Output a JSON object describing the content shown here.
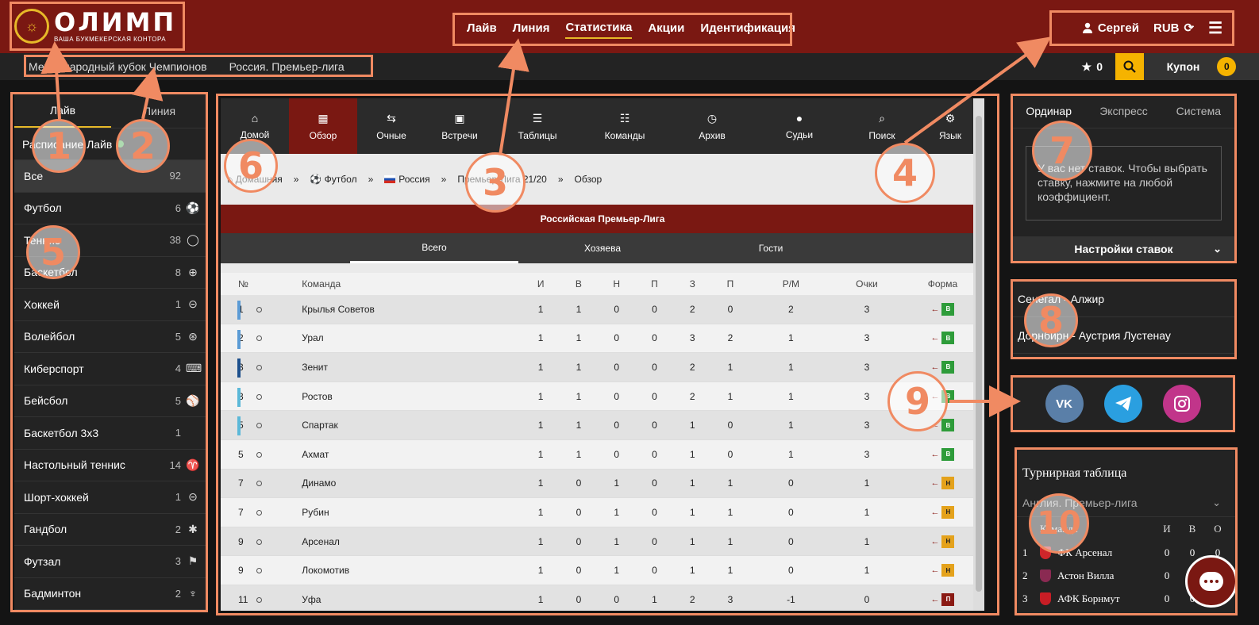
{
  "logo": {
    "name": "ОЛИМП",
    "tagline": "ВАША БУКМЕКЕРСКАЯ КОНТОРА"
  },
  "topnav": [
    "Лайв",
    "Линия",
    "Статистика",
    "Акции",
    "Идентификация"
  ],
  "user": {
    "name": "Сергей",
    "currency": "RUB"
  },
  "subbar": {
    "crumbs": [
      "Международный кубок Чемпионов",
      "Россия. Премьер-лига"
    ],
    "favorites": "0",
    "coupon_label": "Купон",
    "coupon_count": "0"
  },
  "left": {
    "tabs": [
      "Лайв",
      "Линия"
    ],
    "schedule": "Расписание Лайв",
    "sports": [
      {
        "name": "Все",
        "count": "92",
        "icon": "none"
      },
      {
        "name": "Футбол",
        "count": "6",
        "icon": "soccer-icon"
      },
      {
        "name": "Теннис",
        "count": "38",
        "icon": "tennis-icon"
      },
      {
        "name": "Баскетбол",
        "count": "8",
        "icon": "basketball-icon"
      },
      {
        "name": "Хоккей",
        "count": "1",
        "icon": "puck-icon"
      },
      {
        "name": "Волейбол",
        "count": "5",
        "icon": "volleyball-icon"
      },
      {
        "name": "Киберспорт",
        "count": "4",
        "icon": "gamepad-icon"
      },
      {
        "name": "Бейсбол",
        "count": "5",
        "icon": "baseball-icon"
      },
      {
        "name": "Баскетбол 3х3",
        "count": "1",
        "icon": "none"
      },
      {
        "name": "Настольный теннис",
        "count": "14",
        "icon": "pingpong-icon"
      },
      {
        "name": "Шорт-хоккей",
        "count": "1",
        "icon": "puck-icon"
      },
      {
        "name": "Гандбол",
        "count": "2",
        "icon": "handball-icon"
      },
      {
        "name": "Футзал",
        "count": "3",
        "icon": "futsal-icon"
      },
      {
        "name": "Бадминтон",
        "count": "2",
        "icon": "shuttlecock-icon"
      }
    ]
  },
  "stats": {
    "tabs": [
      "Домой",
      "Обзор",
      "Очные",
      "Встречи",
      "Таблицы",
      "Команды",
      "Архив",
      "Судьи",
      "Поиск",
      "Язык"
    ],
    "breadcrumb": [
      "Домашняя",
      "Футбол",
      "Россия",
      "Премьер-Лига 21/20",
      "Обзор"
    ],
    "league_title": "Российская Премьер-Лига",
    "home_away_tabs": [
      "Всего",
      "Хозяева",
      "Гости"
    ],
    "columns": [
      "№",
      "Команда",
      "И",
      "В",
      "Н",
      "П",
      "З",
      "П",
      "Р/М",
      "Очки",
      "Форма"
    ],
    "rows": [
      {
        "pos": "1",
        "team": "Крылья Советов",
        "p": "1",
        "w": "1",
        "d": "0",
        "l": "0",
        "gf": "2",
        "ga": "0",
        "gd": "2",
        "pts": "3",
        "form": "В",
        "mark": "#5b9bd5"
      },
      {
        "pos": "2",
        "team": "Урал",
        "p": "1",
        "w": "1",
        "d": "0",
        "l": "0",
        "gf": "3",
        "ga": "2",
        "gd": "1",
        "pts": "3",
        "form": "В",
        "mark": "#5b9bd5"
      },
      {
        "pos": "3",
        "team": "Зенит",
        "p": "1",
        "w": "1",
        "d": "0",
        "l": "0",
        "gf": "2",
        "ga": "1",
        "gd": "1",
        "pts": "3",
        "form": "В",
        "mark": "#1c4f8c"
      },
      {
        "pos": "3",
        "team": "Ростов",
        "p": "1",
        "w": "1",
        "d": "0",
        "l": "0",
        "gf": "2",
        "ga": "1",
        "gd": "1",
        "pts": "3",
        "form": "В",
        "mark": "#5bb8d8"
      },
      {
        "pos": "5",
        "team": "Спартак",
        "p": "1",
        "w": "1",
        "d": "0",
        "l": "0",
        "gf": "1",
        "ga": "0",
        "gd": "1",
        "pts": "3",
        "form": "В",
        "mark": "#5bb8d8"
      },
      {
        "pos": "5",
        "team": "Ахмат",
        "p": "1",
        "w": "1",
        "d": "0",
        "l": "0",
        "gf": "1",
        "ga": "0",
        "gd": "1",
        "pts": "3",
        "form": "В",
        "mark": ""
      },
      {
        "pos": "7",
        "team": "Динамо",
        "p": "1",
        "w": "0",
        "d": "1",
        "l": "0",
        "gf": "1",
        "ga": "1",
        "gd": "0",
        "pts": "1",
        "form": "Н",
        "mark": ""
      },
      {
        "pos": "7",
        "team": "Рубин",
        "p": "1",
        "w": "0",
        "d": "1",
        "l": "0",
        "gf": "1",
        "ga": "1",
        "gd": "0",
        "pts": "1",
        "form": "Н",
        "mark": ""
      },
      {
        "pos": "9",
        "team": "Арсенал",
        "p": "1",
        "w": "0",
        "d": "1",
        "l": "0",
        "gf": "1",
        "ga": "1",
        "gd": "0",
        "pts": "1",
        "form": "Н",
        "mark": ""
      },
      {
        "pos": "9",
        "team": "Локомотив",
        "p": "1",
        "w": "0",
        "d": "1",
        "l": "0",
        "gf": "1",
        "ga": "1",
        "gd": "0",
        "pts": "1",
        "form": "Н",
        "mark": ""
      },
      {
        "pos": "11",
        "team": "Уфа",
        "p": "1",
        "w": "0",
        "d": "0",
        "l": "1",
        "gf": "2",
        "ga": "3",
        "gd": "-1",
        "pts": "0",
        "form": "П",
        "mark": ""
      }
    ]
  },
  "betslip": {
    "tabs": [
      "Ординар",
      "Экспресс",
      "Система"
    ],
    "empty": "У вас нет ставок. Чтобы выбрать ставку, нажмите на любой коэффициент.",
    "settings": "Настройки ставок"
  },
  "matches": [
    "Сенегал - Алжир",
    "Дорнбирн - Аустрия Лустенау"
  ],
  "social": {
    "vk": "VK"
  },
  "standings": {
    "title": "Турнирная таблица",
    "league": "Англия. Премьер-лига",
    "head": {
      "team": "Команда",
      "cols": [
        "И",
        "В",
        "О"
      ]
    },
    "rows": [
      {
        "rank": "1",
        "team": "ФК Арсенал",
        "p": "0",
        "w": "0",
        "o": "0",
        "crest": "#d0262a"
      },
      {
        "rank": "2",
        "team": "Астон Вилла",
        "p": "0",
        "w": "0",
        "o": "0",
        "crest": "#8a2a52"
      },
      {
        "rank": "3",
        "team": "АФК Борнмут",
        "p": "0",
        "w": "0",
        "o": "0",
        "crest": "#c81d25"
      }
    ]
  },
  "annotations": [
    "1",
    "2",
    "3",
    "4",
    "5",
    "6",
    "7",
    "8",
    "9",
    "10"
  ],
  "colors": {
    "brand": "#7a1812",
    "accent": "#e7b928",
    "annotation": "#f08a62"
  }
}
